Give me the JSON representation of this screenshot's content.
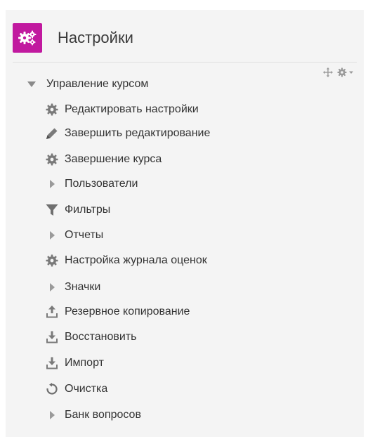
{
  "block": {
    "title": "Настройки",
    "logo_icon": "settings-gears-icon",
    "accent_color": "#c1199f",
    "controls": [
      {
        "name": "move-icon"
      },
      {
        "name": "gear-menu-icon"
      }
    ]
  },
  "tree": {
    "root": {
      "label": "Управление курсом",
      "icon": "caret-down-icon",
      "expanded": true
    },
    "items": [
      {
        "label": "Редактировать настройки",
        "icon": "gear-icon"
      },
      {
        "label": "Завершить редактирование",
        "icon": "pencil-icon"
      },
      {
        "label": "Завершение курса",
        "icon": "gear-icon"
      },
      {
        "label": "Пользователи",
        "icon": "caret-right-icon"
      },
      {
        "label": "Фильтры",
        "icon": "filter-icon"
      },
      {
        "label": "Отчеты",
        "icon": "caret-right-icon"
      },
      {
        "label": "Настройка журнала оценок",
        "icon": "gear-icon"
      },
      {
        "label": "Значки",
        "icon": "caret-right-icon"
      },
      {
        "label": "Резервное копирование",
        "icon": "backup-upload-icon"
      },
      {
        "label": "Восстановить",
        "icon": "restore-download-icon"
      },
      {
        "label": "Импорт",
        "icon": "import-download-icon"
      },
      {
        "label": "Очистка",
        "icon": "reset-refresh-icon"
      },
      {
        "label": "Банк вопросов",
        "icon": "caret-right-icon"
      }
    ]
  }
}
